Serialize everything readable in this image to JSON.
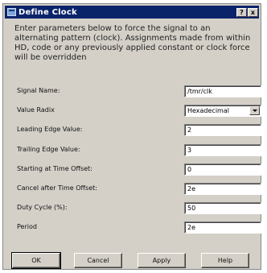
{
  "dialog": {
    "title": "Define Clock",
    "title_buttons": {
      "help": "?",
      "close": "x"
    },
    "description": "Enter parameters below to force the signal to an alternating pattern (clock). Assignments made from within HD, code or any previously applied constant or clock force will be overridden"
  },
  "form": {
    "fields": [
      {
        "label": "Signal Name:",
        "value": "/tmr/clk"
      },
      {
        "label": "Value Radix",
        "value": "Hexadecimal"
      },
      {
        "label": "Leading Edge Value:",
        "value": "2"
      },
      {
        "label": "Trailing Edge Value:",
        "value": "3"
      },
      {
        "label": "Starting at Time Offset:",
        "value": "0"
      },
      {
        "label": "Cancel after Time Offset:",
        "value": "2e"
      },
      {
        "label": "Duty Cycle (%):",
        "value": "50"
      },
      {
        "label": "Period",
        "value": "2e"
      }
    ]
  },
  "buttons": {
    "ok": "OK",
    "cancel": "Cancel",
    "apply": "Apply",
    "help": "Help"
  }
}
